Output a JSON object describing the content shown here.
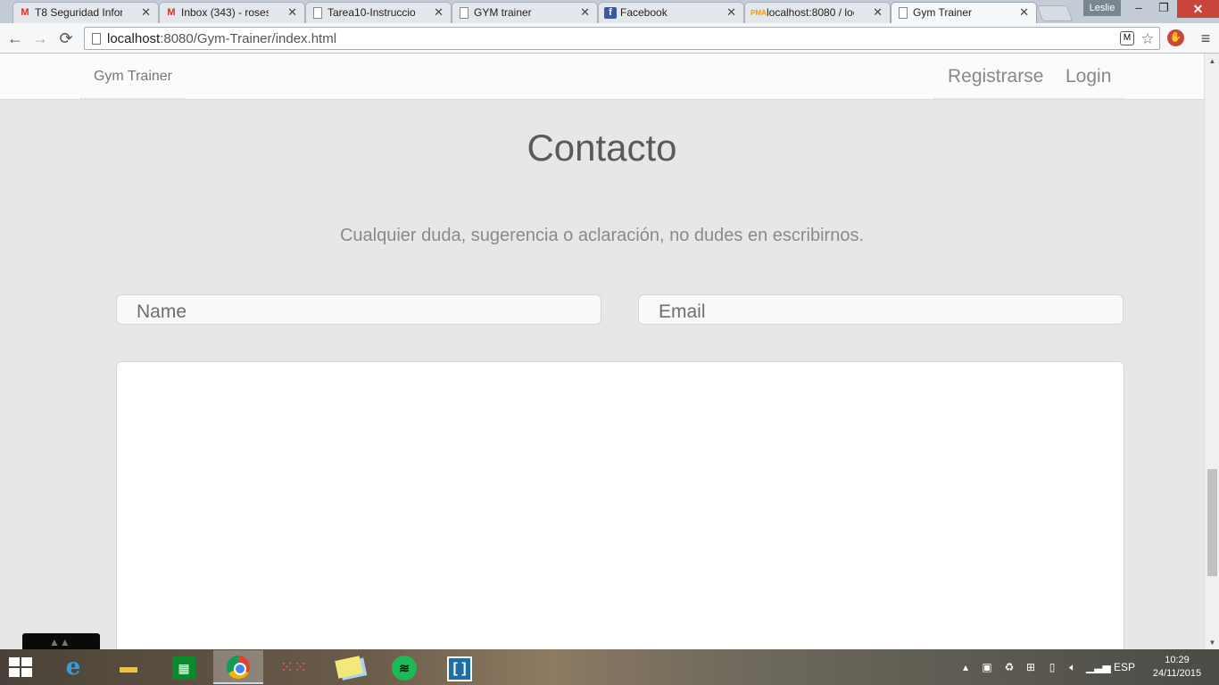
{
  "browser": {
    "tabs": [
      {
        "title": "T8 Seguridad Inform",
        "icon": "gmail-icon",
        "active": false
      },
      {
        "title": "Inbox (343) - roses.le",
        "icon": "gmail-icon",
        "active": false
      },
      {
        "title": "Tarea10-Instruccione",
        "icon": "page-icon",
        "active": false
      },
      {
        "title": "GYM trainer",
        "icon": "page-icon",
        "active": false
      },
      {
        "title": "Facebook",
        "icon": "facebook-icon",
        "active": false
      },
      {
        "title": "localhost:8080 / loca",
        "icon": "phpmyadmin-icon",
        "active": false
      },
      {
        "title": "Gym Trainer",
        "icon": "page-icon",
        "active": true
      }
    ],
    "profile_name": "Leslie",
    "url_host": "localhost",
    "url_path": ":8080/Gym-Trainer/index.html"
  },
  "site": {
    "brand": "Gym Trainer",
    "nav": {
      "register": "Registrarse",
      "login": "Login"
    },
    "contact": {
      "title": "Contacto",
      "subtitle": "Cualquier duda, sugerencia o aclaración, no dudes en escribirnos.",
      "name_placeholder": "Name",
      "email_placeholder": "Email",
      "message_value": ""
    }
  },
  "taskbar": {
    "language": "ESP",
    "time": "10:29",
    "date": "24/11/2015"
  }
}
